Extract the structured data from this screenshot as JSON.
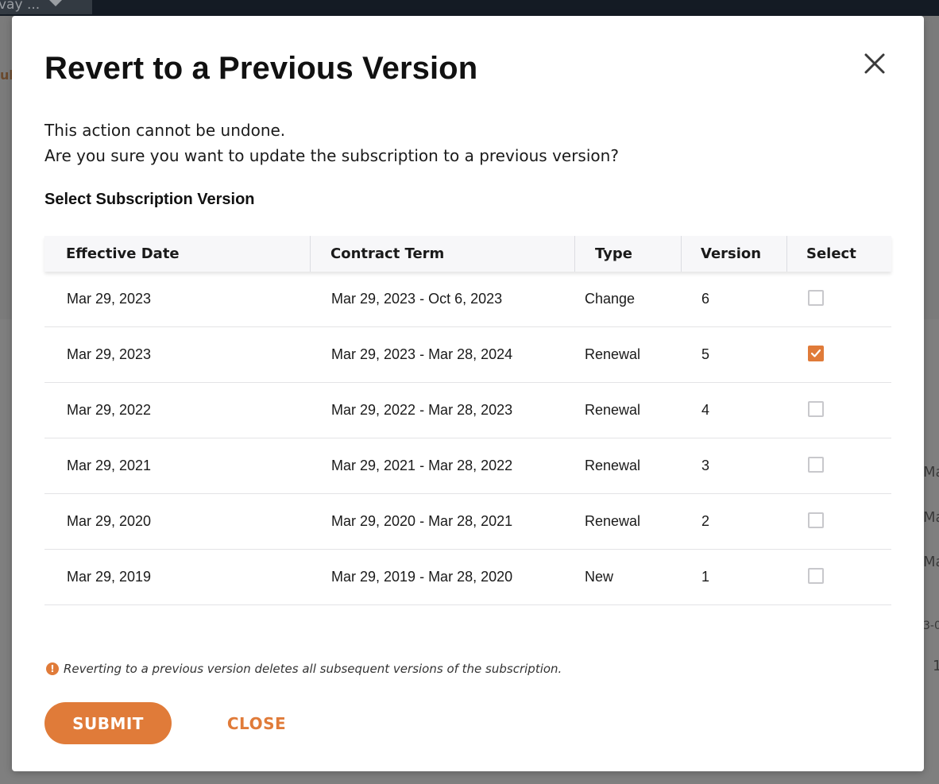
{
  "background": {
    "dropdown_label": "vay ...",
    "crumb_fragment": "ub",
    "side_fragments": [
      "Ma",
      "Ma",
      "Ma",
      "3-0",
      "1"
    ]
  },
  "modal": {
    "title": "Revert to a Previous Version",
    "intro_line1": "This action cannot be undone.",
    "intro_line2": "Are you sure you want to update the subscription to a previous version?",
    "section_label": "Select Subscription Version",
    "table": {
      "headers": {
        "effective_date": "Effective Date",
        "contract_term": "Contract Term",
        "type": "Type",
        "version": "Version",
        "select": "Select"
      },
      "rows": [
        {
          "effective_date": "Mar 29, 2023",
          "contract_term": "Mar 29, 2023 - Oct 6, 2023",
          "type": "Change",
          "version": "6",
          "selected": false
        },
        {
          "effective_date": "Mar 29, 2023",
          "contract_term": "Mar 29, 2023 - Mar 28, 2024",
          "type": "Renewal",
          "version": "5",
          "selected": true
        },
        {
          "effective_date": "Mar 29, 2022",
          "contract_term": "Mar 29, 2022 - Mar 28, 2023",
          "type": "Renewal",
          "version": "4",
          "selected": false
        },
        {
          "effective_date": "Mar 29, 2021",
          "contract_term": "Mar 29, 2021 - Mar 28, 2022",
          "type": "Renewal",
          "version": "3",
          "selected": false
        },
        {
          "effective_date": "Mar 29, 2020",
          "contract_term": "Mar 29, 2020 - Mar 28, 2021",
          "type": "Renewal",
          "version": "2",
          "selected": false
        },
        {
          "effective_date": "Mar 29, 2019",
          "contract_term": "Mar 29, 2019 - Mar 28, 2020",
          "type": "New",
          "version": "1",
          "selected": false
        }
      ]
    },
    "warning_icon": "!",
    "warning_text": "Reverting to a previous version deletes all subsequent versions of the subscription.",
    "submit_label": "SUBMIT",
    "close_label": "CLOSE"
  },
  "colors": {
    "accent": "#e07b39",
    "overlay": "#7e7e7e",
    "header_bg": "#f7f7f9"
  },
  "icons": {
    "close": "close-icon",
    "check": "check-icon",
    "warning": "warning-icon",
    "dropdown": "chevron-down-icon"
  }
}
